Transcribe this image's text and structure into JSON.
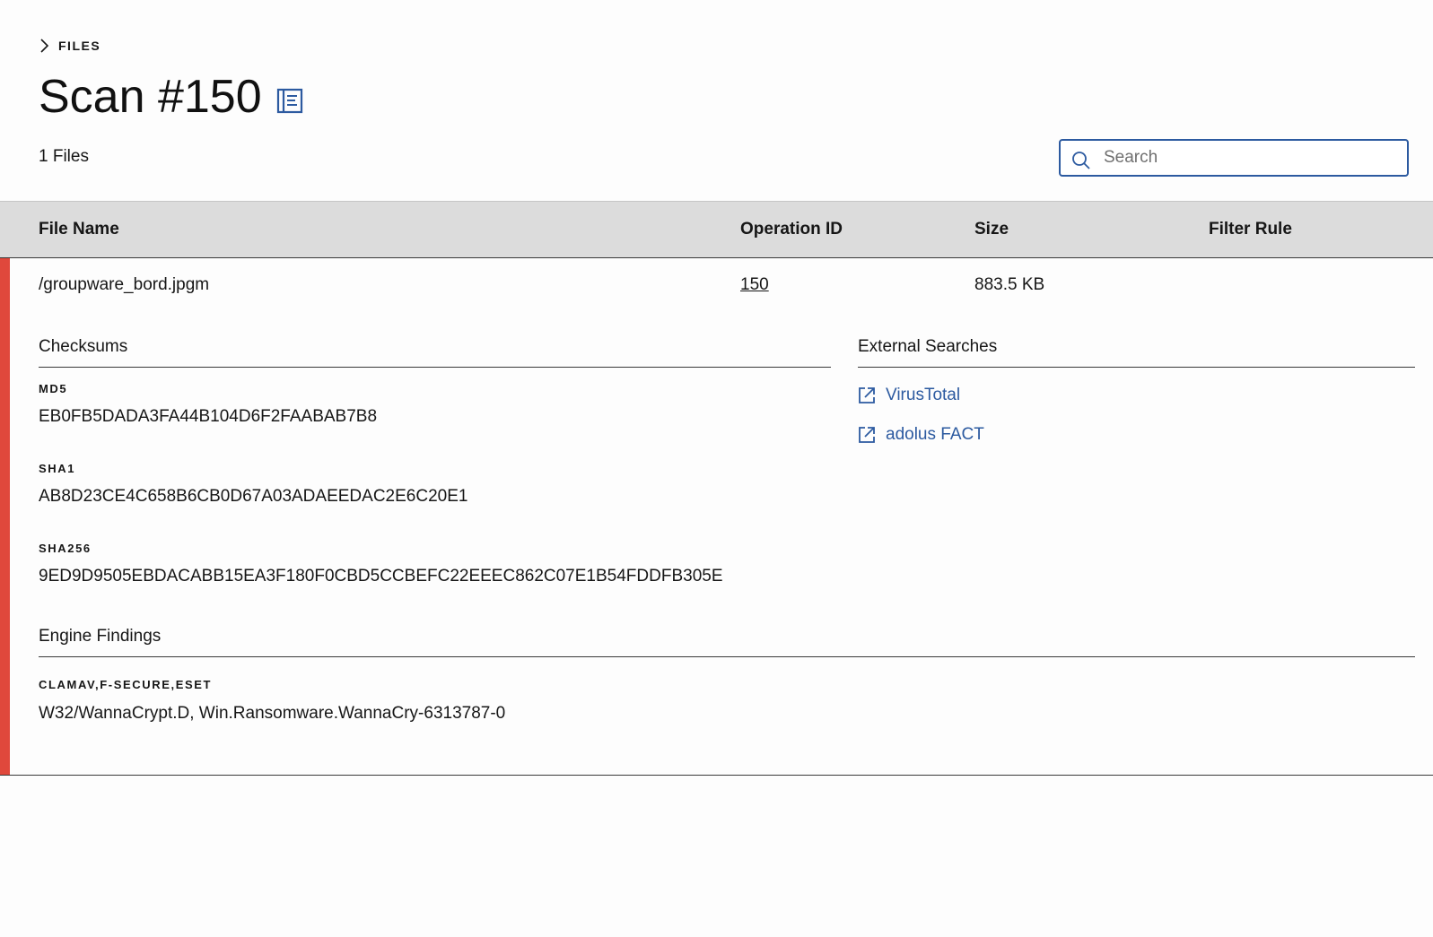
{
  "breadcrumb": {
    "label": "FILES"
  },
  "header": {
    "title": "Scan #150",
    "file_count": "1 Files"
  },
  "search": {
    "placeholder": "Search",
    "value": ""
  },
  "table": {
    "columns": [
      "File Name",
      "Operation ID",
      "Size",
      "Filter Rule"
    ],
    "rows": [
      {
        "file_name": "/groupware_bord.jpgm",
        "operation_id": "150",
        "size": "883.5 KB",
        "filter_rule": "",
        "details": {
          "checksums_title": "Checksums",
          "checksums": [
            {
              "label": "MD5",
              "value": "EB0FB5DADA3FA44B104D6F2FAABAB7B8"
            },
            {
              "label": "SHA1",
              "value": "AB8D23CE4C658B6CB0D67A03ADAEEDAC2E6C20E1"
            },
            {
              "label": "SHA256",
              "value": "9ED9D9505EBDACABB15EA3F180F0CBD5CCBEFC22EEEC862C07E1B54FDDFB305E"
            }
          ],
          "external_title": "External Searches",
          "external_links": [
            {
              "label": "VirusTotal",
              "icon": "launch-icon"
            },
            {
              "label": "adolus FACT",
              "icon": "launch-icon"
            }
          ],
          "engine_title": "Engine Findings",
          "engine_label": "CLAMAV,F-SECURE,ESET",
          "engine_value": "W32/WannaCrypt.D, Win.Ransomware.WannaCry-6313787-0"
        }
      }
    ]
  },
  "colors": {
    "accent": "#2c5aa0",
    "row_flag": "#e0483c",
    "header_bg": "#dcdcdc",
    "background": "#fdfdfd"
  },
  "icons": {
    "breadcrumb": "chevron-right-icon",
    "title": "book-icon",
    "search": "search-icon",
    "external": "launch-icon"
  }
}
